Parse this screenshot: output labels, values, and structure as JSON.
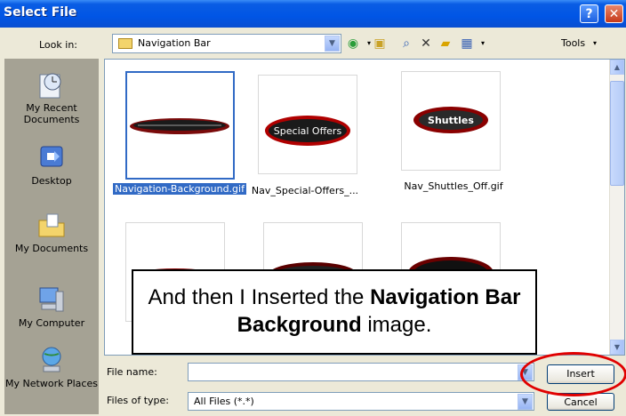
{
  "window": {
    "title": "Select File"
  },
  "lookin": {
    "label": "Look in:",
    "value": "Navigation Bar"
  },
  "toolbar": {
    "tools_label": "Tools"
  },
  "places": [
    {
      "label": "My Recent Documents",
      "icon": "recent-documents-icon"
    },
    {
      "label": "Desktop",
      "icon": "desktop-icon"
    },
    {
      "label": "My Documents",
      "icon": "my-documents-icon"
    },
    {
      "label": "My Computer",
      "icon": "my-computer-icon"
    },
    {
      "label": "My Network Places",
      "icon": "network-places-icon"
    }
  ],
  "files": [
    {
      "name": "Navigation-Background.gif",
      "selected": true,
      "button_text": ""
    },
    {
      "name": "Nav_Special-Offers_...",
      "selected": false,
      "button_text": "Special Offers"
    },
    {
      "name": "Nav_Shuttles_Off.gif",
      "selected": false,
      "button_text": "Shuttles"
    }
  ],
  "filename": {
    "label": "File name:",
    "value": ""
  },
  "filetype": {
    "label": "Files of type:",
    "value": "All Files (*.*)"
  },
  "buttons": {
    "insert": "Insert",
    "cancel": "Cancel"
  },
  "callout": {
    "text_pre": "And then I Inserted the ",
    "text_bold": "Navigation Bar Background",
    "text_post": " image."
  },
  "colors": {
    "accent": "#316AC5",
    "highlight_oval": "#E00000"
  }
}
